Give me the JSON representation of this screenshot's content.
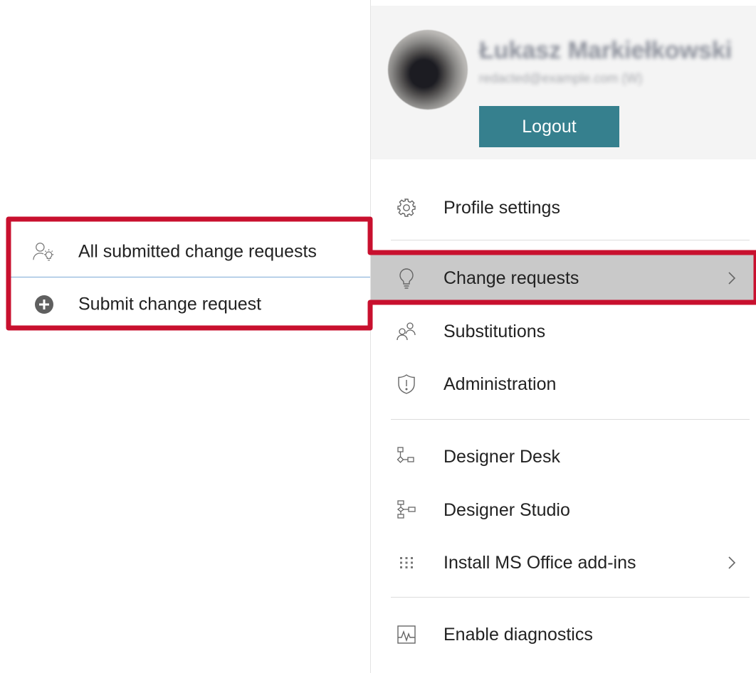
{
  "user": {
    "name": "Łukasz Markiełkowski",
    "email": "redacted@example.com (W)",
    "logout_label": "Logout"
  },
  "menu": {
    "items": [
      {
        "label": "Profile settings",
        "icon": "gear-icon"
      },
      {
        "label": "Change requests",
        "icon": "lightbulb-icon",
        "has_submenu": true,
        "active": true
      },
      {
        "label": "Substitutions",
        "icon": "substitution-users-icon"
      },
      {
        "label": "Administration",
        "icon": "shield-alert-icon"
      },
      {
        "label": "Designer Desk",
        "icon": "designer-desk-icon"
      },
      {
        "label": "Designer Studio",
        "icon": "designer-studio-icon"
      },
      {
        "label": "Install MS Office add-ins",
        "icon": "grid-dots-icon",
        "has_submenu": true
      },
      {
        "label": "Enable diagnostics",
        "icon": "diagnostics-chart-icon"
      }
    ]
  },
  "flyout": {
    "items": [
      {
        "label": "All submitted change requests",
        "icon": "user-lightbulb-icon"
      },
      {
        "label": "Submit change request",
        "icon": "plus-circle-icon"
      }
    ]
  },
  "colors": {
    "logout_bg": "#36808e",
    "active_bg": "#c9c9c9",
    "highlight": "#c8102e",
    "card_bg": "#f4f4f4"
  }
}
